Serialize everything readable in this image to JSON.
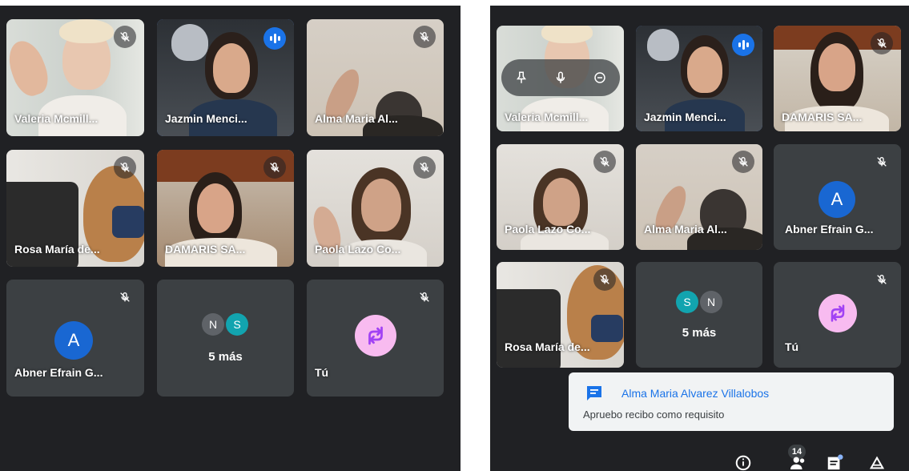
{
  "left_panel": {
    "tiles": [
      {
        "name": "Valeria Mcmill..."
      },
      {
        "name": "Jazmin Menci..."
      },
      {
        "name": "Alma Maria Al..."
      },
      {
        "name": "Rosa María de..."
      },
      {
        "name": "DAMARIS SA..."
      },
      {
        "name": "Paola Lazo Co..."
      },
      {
        "name": "Abner Efrain G...",
        "initial": "A"
      },
      {
        "more": "5 más",
        "initials": [
          "N",
          "S"
        ]
      },
      {
        "name": "Tú"
      }
    ]
  },
  "right_panel": {
    "tiles": [
      {
        "name": "Valeria Mcmill..."
      },
      {
        "name": "Jazmin Menci..."
      },
      {
        "name": "DAMARIS SA..."
      },
      {
        "name": "Paola Lazo Co..."
      },
      {
        "name": "Alma Maria Al..."
      },
      {
        "name": "Abner Efrain G...",
        "initial": "A"
      },
      {
        "name": "Rosa María de..."
      },
      {
        "more": "5 más",
        "initials": [
          "S",
          "N"
        ]
      },
      {
        "name": "Tú"
      }
    ],
    "chat_toast": {
      "sender": "Alma Maria Alvarez Villalobos",
      "message": "Apruebo recibo como requisito"
    },
    "participants_count": "14"
  },
  "colors": {
    "background": "#202124",
    "tile": "#3c4043",
    "speaking_border": "#4f86e6",
    "accent_blue": "#1a73e8",
    "avatar_A": "#1967d2",
    "avatar_N": "#5f6368",
    "avatar_S": "#12a4af",
    "you_avatar": "#f8bbf0",
    "you_glyph": "#a142f4"
  }
}
